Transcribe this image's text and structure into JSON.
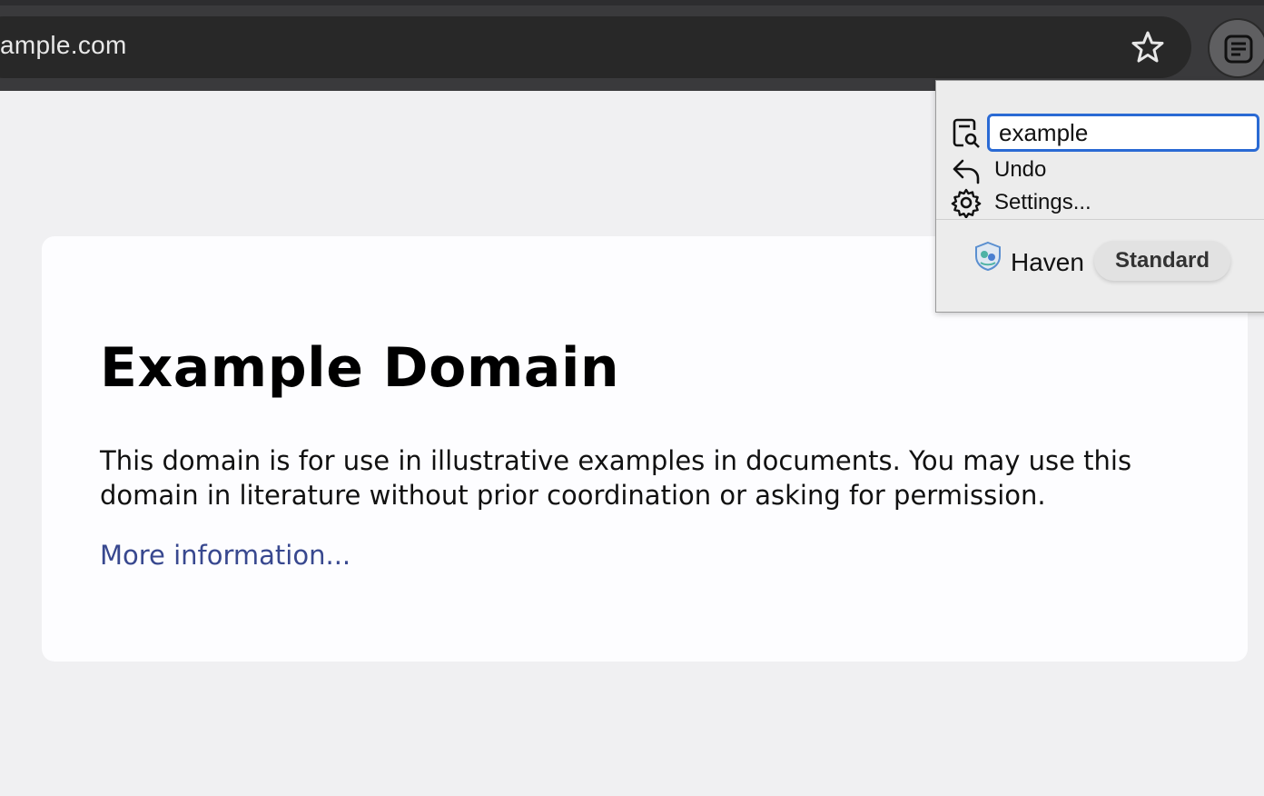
{
  "browser": {
    "url": "ample.com"
  },
  "page": {
    "title": "Example Domain",
    "paragraph": "This domain is for use in illustrative examples in documents. You may use this domain in literature without prior coordination or asking for permission.",
    "link": "More information..."
  },
  "popup": {
    "search_value": "example",
    "undo_label": "Undo",
    "settings_label": "Settings...",
    "brand_name": "Haven",
    "mode_badge": "Standard"
  },
  "colors": {
    "accent_blue": "#2a6ad4",
    "link": "#38488f",
    "chrome_bg": "#3a3a3c"
  },
  "icons": [
    "star-icon",
    "reader-icon",
    "search-doc-icon",
    "undo-icon",
    "gear-icon",
    "haven-logo-icon"
  ]
}
